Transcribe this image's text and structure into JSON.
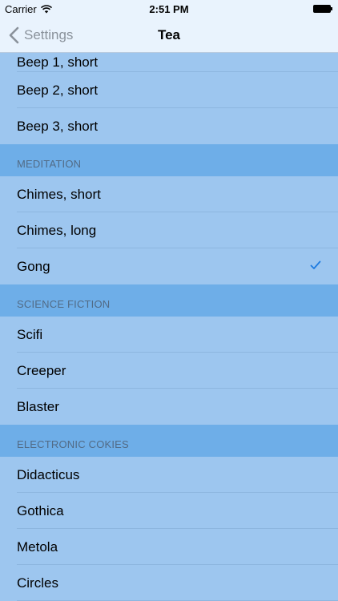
{
  "status_bar": {
    "carrier": "Carrier",
    "time": "2:51 PM"
  },
  "nav": {
    "back_label": "Settings",
    "title": "Tea"
  },
  "colors": {
    "accent": "#1e7be0",
    "row_bg": "#9dc6ef",
    "section_bg": "#6eaee8",
    "header_bg": "#e9f3fd"
  },
  "sections": [
    {
      "items": [
        {
          "label": "Beep 1, short"
        },
        {
          "label": "Beep 2, short"
        },
        {
          "label": "Beep 3, short"
        }
      ]
    },
    {
      "title": "MEDITATION",
      "items": [
        {
          "label": "Chimes, short"
        },
        {
          "label": "Chimes, long"
        },
        {
          "label": "Gong",
          "selected": true
        }
      ]
    },
    {
      "title": "SCIENCE FICTION",
      "items": [
        {
          "label": "Scifi"
        },
        {
          "label": "Creeper"
        },
        {
          "label": "Blaster"
        }
      ]
    },
    {
      "title": "ELECTRONIC COKIES",
      "items": [
        {
          "label": "Didacticus"
        },
        {
          "label": "Gothica"
        },
        {
          "label": "Metola"
        },
        {
          "label": "Circles"
        }
      ]
    }
  ]
}
